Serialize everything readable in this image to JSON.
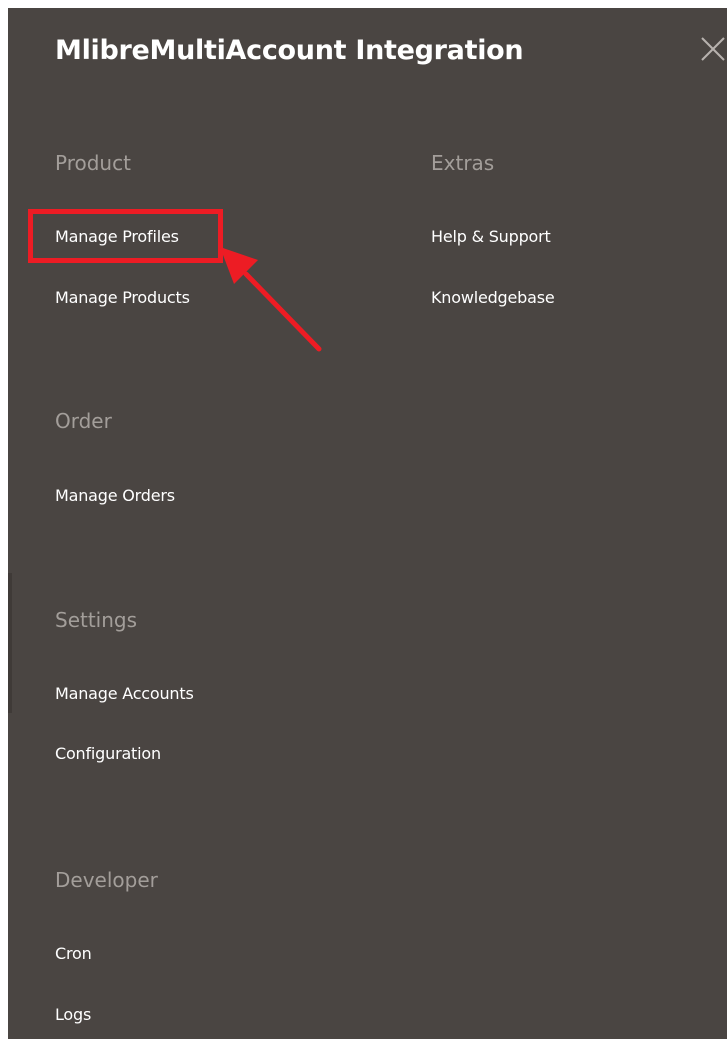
{
  "header": {
    "title": "MlibreMultiAccount Integration",
    "close_icon": "close-icon"
  },
  "sections": {
    "product": {
      "title": "Product",
      "items": [
        "Manage Profiles",
        "Manage Products"
      ]
    },
    "extras": {
      "title": "Extras",
      "items": [
        "Help & Support",
        "Knowledgebase"
      ]
    },
    "order": {
      "title": "Order",
      "items": [
        "Manage Orders"
      ]
    },
    "settings": {
      "title": "Settings",
      "items": [
        "Manage Accounts",
        "Configuration"
      ]
    },
    "developer": {
      "title": "Developer",
      "items": [
        "Cron",
        "Logs"
      ]
    }
  },
  "annotation": {
    "highlight_color": "#ed1c24",
    "highlighted_item": "Manage Profiles",
    "arrow_icon": "red-arrow-icon"
  },
  "colors": {
    "panel_background": "#4a4542",
    "section_title": "#a39e9a",
    "menu_item": "#ffffff"
  }
}
